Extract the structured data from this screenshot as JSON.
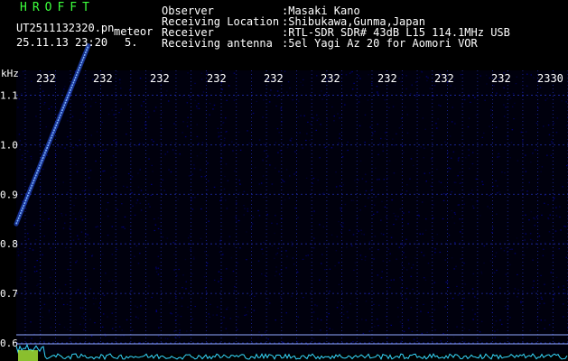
{
  "header": {
    "app_name": "HROFFT",
    "file_name": "UT2511132320.pn",
    "mode_label": "meteor",
    "datetime": "25.11.13 23:20",
    "extra_value": "5."
  },
  "info": {
    "labels": [
      "Observer",
      "Receiving Location",
      "Receiver",
      "Receiving antenna"
    ],
    "values": [
      ":Masaki Kano",
      ":Shibukawa,Gunma,Japan",
      ":RTL-SDR SDR# 43dB L15 114.1MHz USB",
      ":5el Yagi Az 20 for Aomori VOR"
    ]
  },
  "axis": {
    "y_unit": "kHz",
    "y_ticks": [
      "1.1",
      "1.0",
      "0.9",
      "0.8",
      "0.7",
      "0.6"
    ],
    "y_tick_values": [
      1.1,
      1.0,
      0.9,
      0.8,
      0.7,
      0.6
    ],
    "y_range": [
      0.6,
      1.15
    ],
    "x_ticks": [
      "232",
      "232",
      "232",
      "232",
      "232",
      "232",
      "232",
      "232",
      "232",
      "2330"
    ],
    "x_range_minutes": [
      0,
      10
    ]
  },
  "colors": {
    "background": "#000000",
    "grid": "#1e2aa8",
    "signal": "#2a5cff",
    "signal_core": "#7fb4ff",
    "baseline": "#8fa8ff",
    "noise_strip": "#35d7ff",
    "text": "#ffffff",
    "title": "#3cff3c"
  },
  "meteor_trace": {
    "start": {
      "minute": 0.0,
      "khz": 0.84
    },
    "end": {
      "minute": 1.33,
      "khz": 1.2
    }
  }
}
